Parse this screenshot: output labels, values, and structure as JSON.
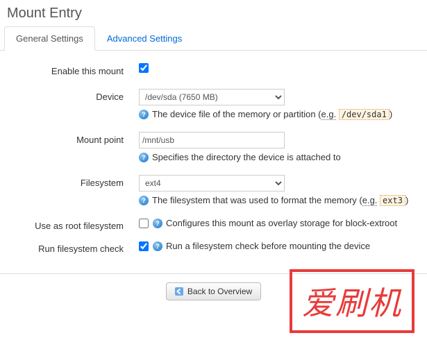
{
  "title": "Mount Entry",
  "tabs": {
    "general": "General Settings",
    "advanced": "Advanced Settings"
  },
  "fields": {
    "enable": {
      "label": "Enable this mount",
      "checked": true
    },
    "device": {
      "label": "Device",
      "value": "/dev/sda (7650 MB)",
      "hint_pre": "The device file of the memory or partition (",
      "hint_eg": "e.g.",
      "hint_code": "/dev/sda1",
      "hint_post": ")"
    },
    "mountpoint": {
      "label": "Mount point",
      "value": "/mnt/usb",
      "hint": "Specifies the directory the device is attached to"
    },
    "filesystem": {
      "label": "Filesystem",
      "value": "ext4",
      "hint_pre": "The filesystem that was used to format the memory (",
      "hint_eg": "e.g.",
      "hint_code": "ext3",
      "hint_post": ")"
    },
    "rootfs": {
      "label": "Use as root filesystem",
      "checked": false,
      "hint": "Configures this mount as overlay storage for block-extroot"
    },
    "fsck": {
      "label": "Run filesystem check",
      "checked": true,
      "hint": "Run a filesystem check before mounting the device"
    }
  },
  "footer": {
    "back": "Back to Overview"
  },
  "watermark": "爱刷机"
}
